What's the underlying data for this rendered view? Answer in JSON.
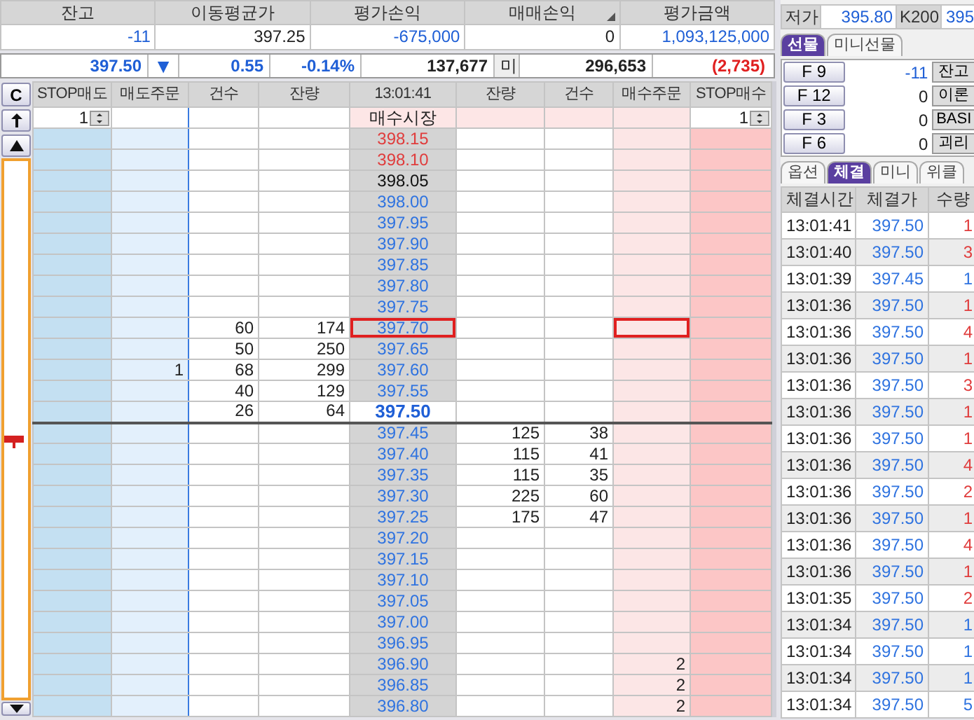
{
  "account": {
    "columns": [
      {
        "label": "잔고",
        "value": "-11",
        "color": "#1f5fd6"
      },
      {
        "label": "이동평균가",
        "value": "397.25",
        "color": "#222222"
      },
      {
        "label": "평가손익",
        "value": "-675,000",
        "color": "#1f5fd6"
      },
      {
        "label": "매매손익",
        "value": "0",
        "color": "#222222"
      },
      {
        "label": "평가금액",
        "value": "1,093,125,000",
        "color": "#1f5fd6"
      }
    ]
  },
  "summary": {
    "price": "397.50",
    "direction_mark": "▼",
    "change": "0.55",
    "change_rate": "-0.14%",
    "volume": "137,677",
    "label": "미",
    "open_interest": "296,653",
    "diff": "(2,735)"
  },
  "order_ladder": {
    "clear_button": "C",
    "columns": [
      "STOP매도",
      "매도주문",
      "건수",
      "잔량",
      "13:01:41",
      "잔량",
      "건수",
      "매수주문",
      "STOP매수"
    ],
    "stop_sell_qty": "1",
    "stop_buy_qty": "1",
    "market_buy": "매수시장",
    "rows": [
      {
        "price": "398.15",
        "color": "#e03c3c",
        "current": false,
        "selected": false
      },
      {
        "price": "398.10",
        "color": "#e03c3c",
        "current": false,
        "selected": false
      },
      {
        "price": "398.05",
        "color": "#111111",
        "current": false,
        "selected": false
      },
      {
        "price": "398.00",
        "color": "#2f73e0",
        "current": false,
        "selected": false
      },
      {
        "price": "397.95",
        "color": "#2f73e0",
        "current": false,
        "selected": false
      },
      {
        "price": "397.90",
        "color": "#2f73e0",
        "current": false,
        "selected": false
      },
      {
        "price": "397.85",
        "color": "#2f73e0",
        "current": false,
        "selected": false
      },
      {
        "price": "397.80",
        "color": "#2f73e0",
        "current": false,
        "selected": false
      },
      {
        "price": "397.75",
        "color": "#2f73e0",
        "current": false,
        "selected": false
      },
      {
        "price": "397.70",
        "color": "#2f73e0",
        "ask_count": "60",
        "ask_qty": "174",
        "current": false,
        "selected": true
      },
      {
        "price": "397.65",
        "color": "#2f73e0",
        "ask_count": "50",
        "ask_qty": "250",
        "current": false,
        "selected": false
      },
      {
        "price": "397.60",
        "color": "#2f73e0",
        "sell_order": "1",
        "ask_count": "68",
        "ask_qty": "299",
        "current": false,
        "selected": false
      },
      {
        "price": "397.55",
        "color": "#2f73e0",
        "ask_count": "40",
        "ask_qty": "129",
        "current": false,
        "selected": false
      },
      {
        "price": "397.50",
        "color": "#1f5fd6",
        "ask_count": "26",
        "ask_qty": "64",
        "current": true,
        "selected": false
      },
      {
        "price": "397.45",
        "color": "#2f73e0",
        "bid_qty": "125",
        "bid_count": "38",
        "current": false,
        "selected": false
      },
      {
        "price": "397.40",
        "color": "#2f73e0",
        "bid_qty": "115",
        "bid_count": "41",
        "current": false,
        "selected": false
      },
      {
        "price": "397.35",
        "color": "#2f73e0",
        "bid_qty": "115",
        "bid_count": "35",
        "current": false,
        "selected": false
      },
      {
        "price": "397.30",
        "color": "#2f73e0",
        "bid_qty": "225",
        "bid_count": "60",
        "current": false,
        "selected": false
      },
      {
        "price": "397.25",
        "color": "#2f73e0",
        "bid_qty": "175",
        "bid_count": "47",
        "current": false,
        "selected": false
      },
      {
        "price": "397.20",
        "color": "#2f73e0",
        "current": false,
        "selected": false
      },
      {
        "price": "397.15",
        "color": "#2f73e0",
        "current": false,
        "selected": false
      },
      {
        "price": "397.10",
        "color": "#2f73e0",
        "current": false,
        "selected": false
      },
      {
        "price": "397.05",
        "color": "#2f73e0",
        "current": false,
        "selected": false
      },
      {
        "price": "397.00",
        "color": "#2f73e0",
        "current": false,
        "selected": false
      },
      {
        "price": "396.95",
        "color": "#2f73e0",
        "current": false,
        "selected": false
      },
      {
        "price": "396.90",
        "color": "#2f73e0",
        "buy_order": "2",
        "current": false,
        "selected": false
      },
      {
        "price": "396.85",
        "color": "#2f73e0",
        "buy_order": "2",
        "current": false,
        "selected": false
      },
      {
        "price": "396.80",
        "color": "#2f73e0",
        "buy_order": "2",
        "current": false,
        "selected": false
      }
    ]
  },
  "quote": {
    "low_label": "저가",
    "low": "395.80",
    "index_label": "K200",
    "index": "395"
  },
  "futures_tabs": [
    {
      "label": "선물",
      "selected": true
    },
    {
      "label": "미니선물",
      "selected": false
    }
  ],
  "futures": [
    {
      "code": "F 9",
      "value": "-11",
      "color": "#1f5fd6",
      "button": "잔고"
    },
    {
      "code": "F 12",
      "value": "0",
      "color": "#222222",
      "button": "이론"
    },
    {
      "code": "F 3",
      "value": "0",
      "color": "#222222",
      "button": "BASI"
    },
    {
      "code": "F 6",
      "value": "0",
      "color": "#222222",
      "button": "괴리"
    }
  ],
  "info_tabs": [
    {
      "label": "옵션",
      "selected": false
    },
    {
      "label": "체결",
      "selected": true
    },
    {
      "label": "미니",
      "selected": false
    },
    {
      "label": "위클",
      "selected": false
    }
  ],
  "trades": {
    "columns": [
      "체결시간",
      "체결가",
      "수량"
    ],
    "rows": [
      {
        "time": "13:01:41",
        "price": "397.50",
        "qty": "1",
        "color": "#e03c3c"
      },
      {
        "time": "13:01:40",
        "price": "397.50",
        "qty": "3",
        "color": "#e03c3c"
      },
      {
        "time": "13:01:39",
        "price": "397.45",
        "qty": "1",
        "color": "#2f73e0"
      },
      {
        "time": "13:01:36",
        "price": "397.50",
        "qty": "1",
        "color": "#e03c3c"
      },
      {
        "time": "13:01:36",
        "price": "397.50",
        "qty": "4",
        "color": "#e03c3c"
      },
      {
        "time": "13:01:36",
        "price": "397.50",
        "qty": "1",
        "color": "#e03c3c"
      },
      {
        "time": "13:01:36",
        "price": "397.50",
        "qty": "3",
        "color": "#e03c3c"
      },
      {
        "time": "13:01:36",
        "price": "397.50",
        "qty": "1",
        "color": "#e03c3c"
      },
      {
        "time": "13:01:36",
        "price": "397.50",
        "qty": "1",
        "color": "#e03c3c"
      },
      {
        "time": "13:01:36",
        "price": "397.50",
        "qty": "4",
        "color": "#e03c3c"
      },
      {
        "time": "13:01:36",
        "price": "397.50",
        "qty": "2",
        "color": "#e03c3c"
      },
      {
        "time": "13:01:36",
        "price": "397.50",
        "qty": "1",
        "color": "#e03c3c"
      },
      {
        "time": "13:01:36",
        "price": "397.50",
        "qty": "4",
        "color": "#e03c3c"
      },
      {
        "time": "13:01:36",
        "price": "397.50",
        "qty": "1",
        "color": "#e03c3c"
      },
      {
        "time": "13:01:35",
        "price": "397.50",
        "qty": "2",
        "color": "#e03c3c"
      },
      {
        "time": "13:01:34",
        "price": "397.50",
        "qty": "1",
        "color": "#2f73e0"
      },
      {
        "time": "13:01:34",
        "price": "397.50",
        "qty": "1",
        "color": "#2f73e0"
      },
      {
        "time": "13:01:34",
        "price": "397.50",
        "qty": "1",
        "color": "#2f73e0"
      },
      {
        "time": "13:01:34",
        "price": "397.50",
        "qty": "5",
        "color": "#2f73e0"
      }
    ]
  }
}
